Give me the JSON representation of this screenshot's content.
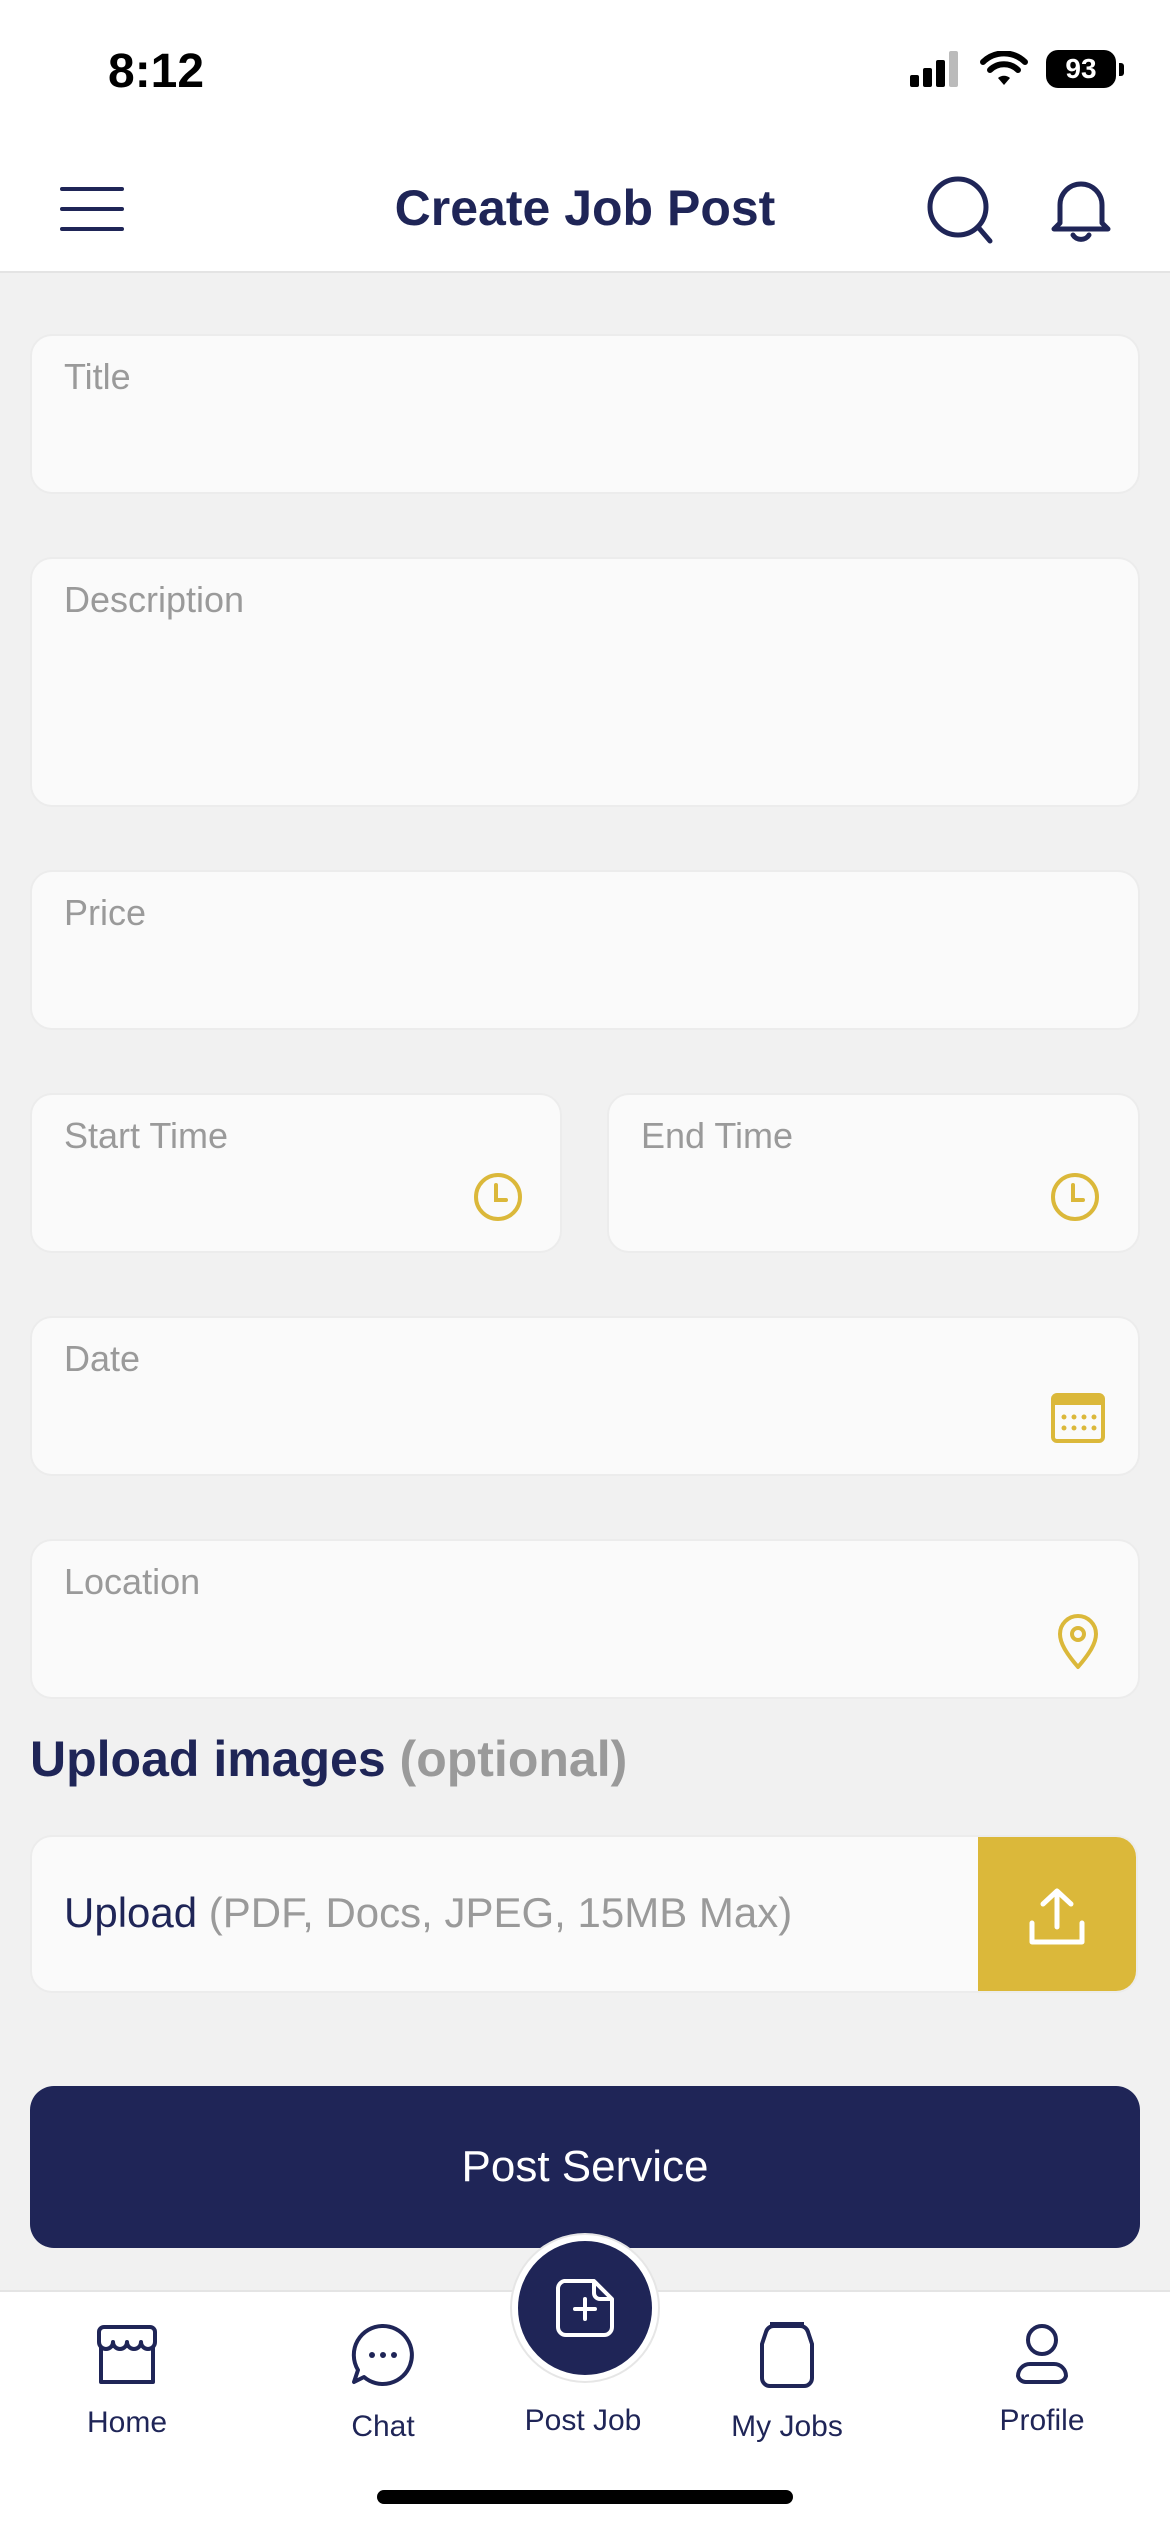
{
  "status_bar": {
    "time": "8:12",
    "battery": "93"
  },
  "header": {
    "title": "Create Job Post"
  },
  "form": {
    "title_placeholder": "Title",
    "description_placeholder": "Description",
    "price_placeholder": "Price",
    "start_time_placeholder": "Start Time",
    "end_time_placeholder": "End Time",
    "date_placeholder": "Date",
    "location_placeholder": "Location"
  },
  "upload_section": {
    "title": "Upload images",
    "optional": "(optional)",
    "upload_label": "Upload",
    "upload_hint": "(PDF, Docs, JPEG, 15MB Max)"
  },
  "submit_label": "Post Service",
  "bottom_nav": {
    "home": "Home",
    "chat": "Chat",
    "post_job": "Post Job",
    "my_jobs": "My Jobs",
    "profile": "Profile"
  },
  "colors": {
    "primary": "#1f2557",
    "accent": "#dbb83a",
    "background": "#f1f1f1"
  },
  "icons": {
    "menu": "hamburger-menu-icon",
    "search": "search-icon",
    "notifications": "bell-icon",
    "time": "clock-icon",
    "date": "calendar-icon",
    "location": "location-pin-icon",
    "upload": "upload-icon"
  }
}
